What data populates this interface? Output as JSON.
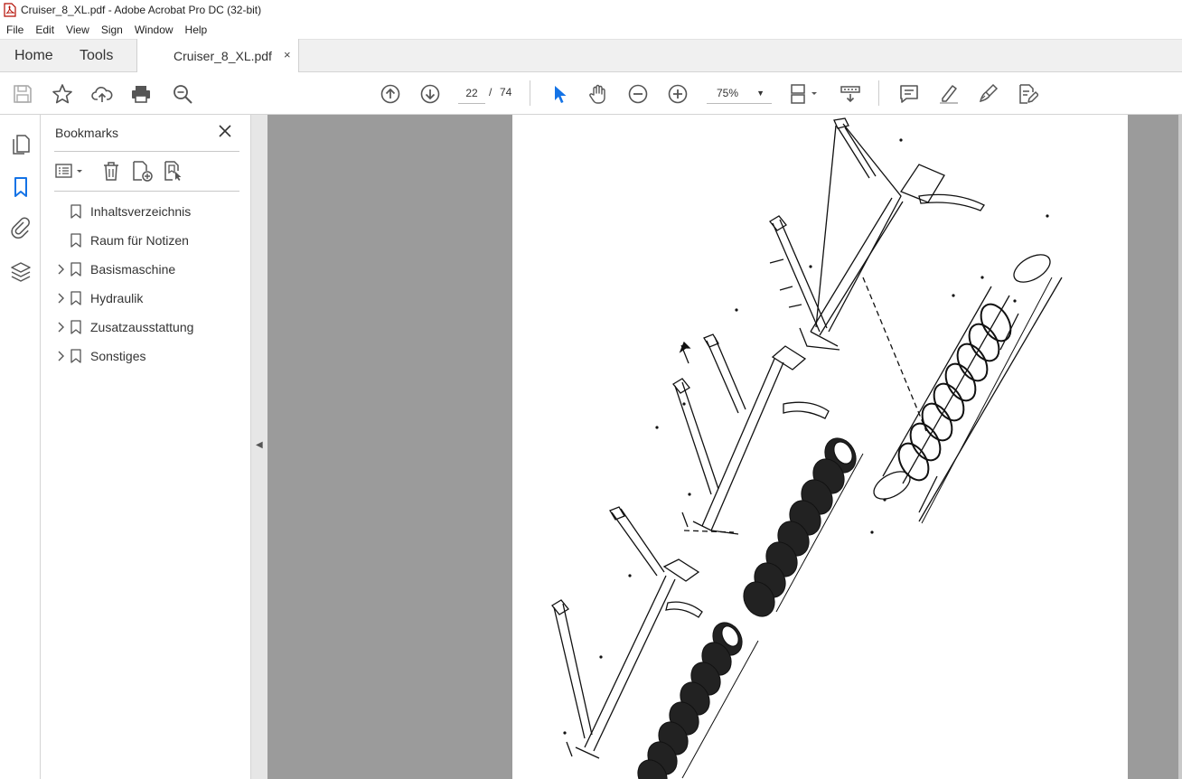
{
  "window": {
    "title": "Cruiser_8_XL.pdf - Adobe Acrobat Pro DC (32-bit)"
  },
  "menu": {
    "file": "File",
    "edit": "Edit",
    "view": "View",
    "sign": "Sign",
    "window": "Window",
    "help": "Help"
  },
  "tabs": {
    "home": "Home",
    "tools": "Tools",
    "document": "Cruiser_8_XL.pdf",
    "close": "×"
  },
  "toolbar": {
    "current_page": "22",
    "page_separator": "/",
    "total_pages": "74",
    "zoom": "75%",
    "accent_color": "#1473e6"
  },
  "bookmarks_panel": {
    "title": "Bookmarks",
    "items": [
      {
        "label": "Inhaltsverzeichnis",
        "expandable": false
      },
      {
        "label": "Raum für Notizen",
        "expandable": false
      },
      {
        "label": "Basismaschine",
        "expandable": true
      },
      {
        "label": "Hydraulik",
        "expandable": true
      },
      {
        "label": "Zusatzausstattung",
        "expandable": true
      },
      {
        "label": "Sonstiges",
        "expandable": true
      }
    ]
  },
  "document": {
    "content": "exploded parts drawing"
  }
}
